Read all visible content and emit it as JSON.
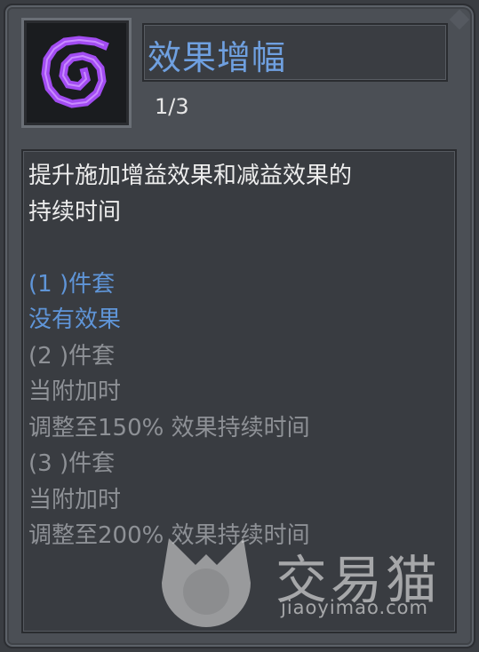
{
  "tooltip": {
    "icon": "purple-spiral-icon",
    "accent_color": "#a24cf2",
    "title": "效果增幅",
    "level": "1/3",
    "description_lines": [
      "提升施加增益效果和减益效果的",
      "持续时间",
      "",
      "(1 )件套",
      "没有效果",
      "(2 )件套",
      "当附加时",
      "调整至150% 效果持续时间",
      "(3 )件套",
      "当附加时",
      "调整至200% 效果持续时间"
    ]
  },
  "watermark": {
    "name": "交易猫",
    "url": "jiaoyimao.com"
  }
}
